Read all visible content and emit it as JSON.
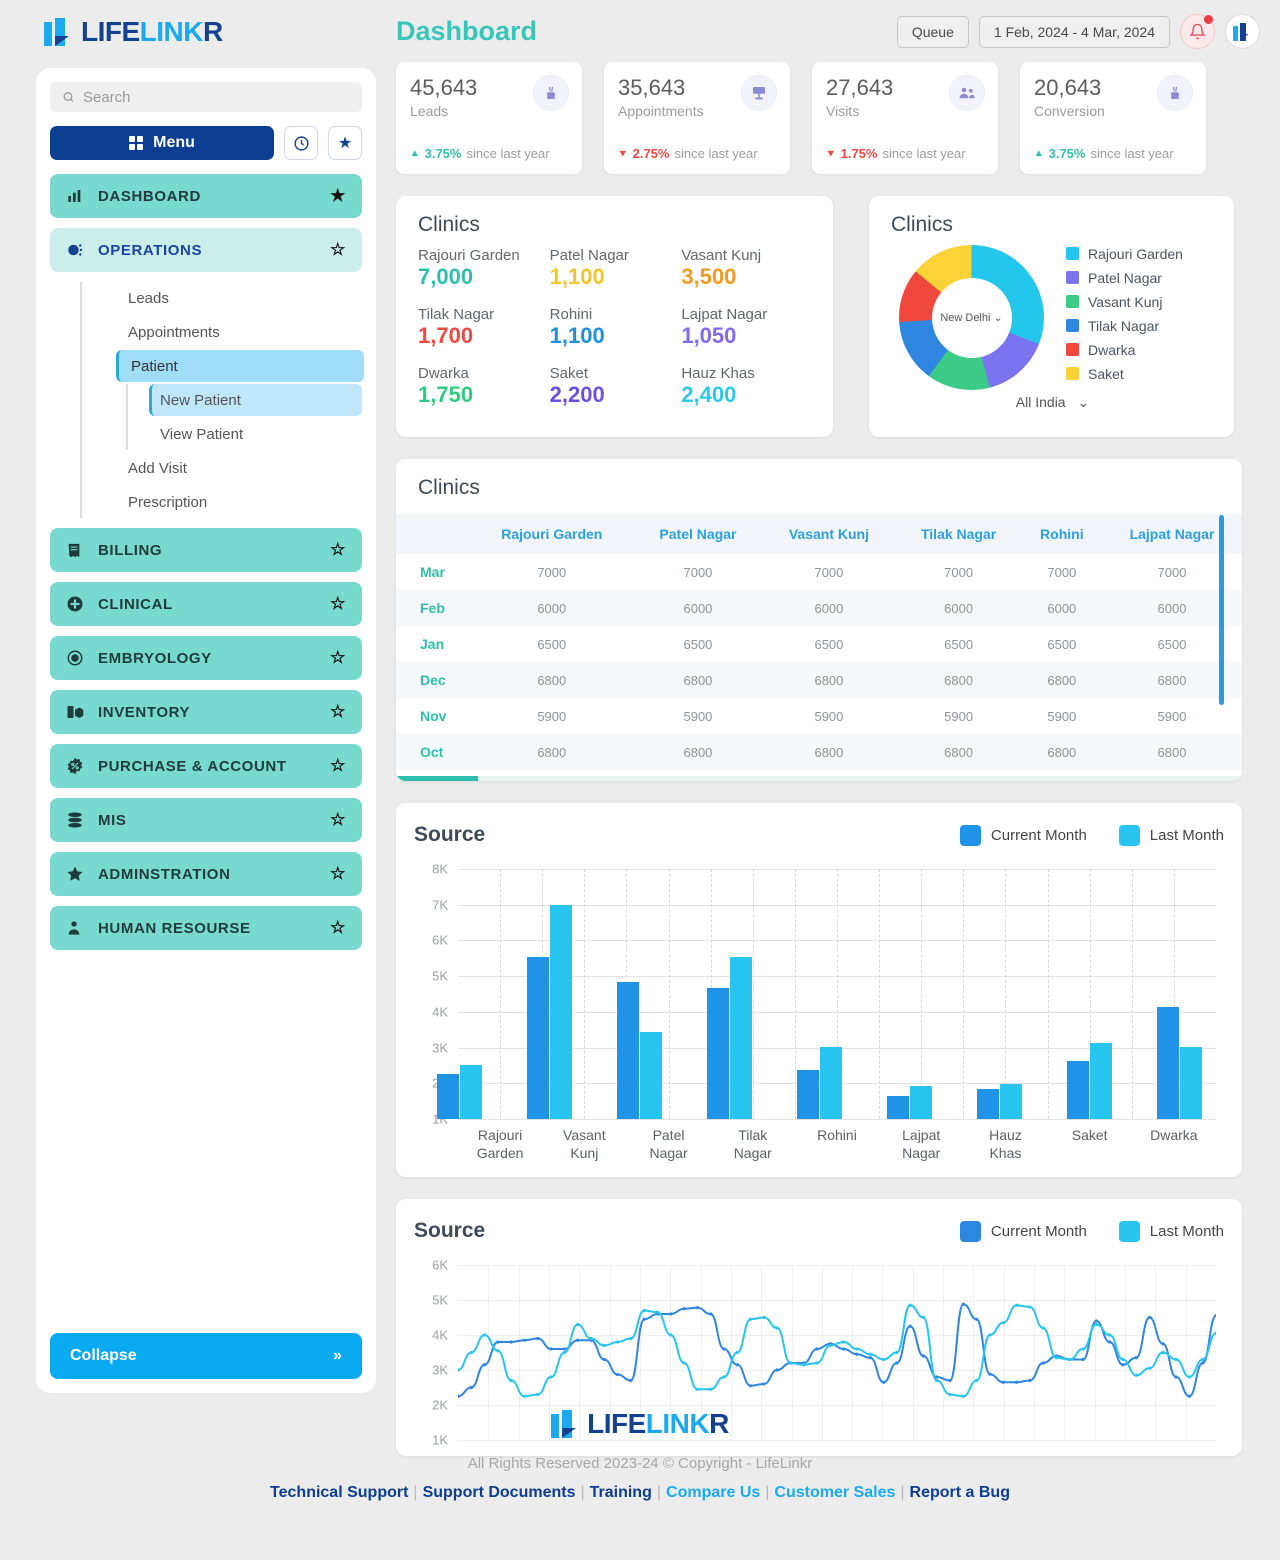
{
  "brand": {
    "part1": "LIFE",
    "part2": "LINK",
    "part3": "R",
    "logo_icon": "lifelinkr-logo-icon"
  },
  "header": {
    "title": "Dashboard",
    "queue_label": "Queue",
    "date_range": "1 Feb, 2024 - 4 Mar, 2024",
    "bell_icon": "notification-bell-icon",
    "logo_icon": "app-logo-icon"
  },
  "sidebar": {
    "search_placeholder": "Search",
    "search_value": "",
    "search_icon": "search-icon",
    "menu_label": "Menu",
    "menu_icon": "grid-icon",
    "history_icon": "history-clock-icon",
    "favorites_icon": "star-filled-icon",
    "collapse_label": "Collapse",
    "collapse_icon": "double-chevron-right-icon",
    "items": [
      {
        "label": "DASHBOARD",
        "icon": "bar-chart-icon",
        "star": "★",
        "style": "solid"
      },
      {
        "label": "OPERATIONS",
        "icon": "gear-cog-icon",
        "star": "☆",
        "style": "pale"
      },
      {
        "label": "BILLING",
        "icon": "receipt-icon",
        "star": "☆",
        "style": "solid"
      },
      {
        "label": "CLINICAL",
        "icon": "plus-circle-icon",
        "star": "☆",
        "style": "solid"
      },
      {
        "label": "EMBRYOLOGY",
        "icon": "embryo-circle-icon",
        "star": "☆",
        "style": "solid"
      },
      {
        "label": "INVENTORY",
        "icon": "inventory-box-icon",
        "star": "☆",
        "style": "solid"
      },
      {
        "label": "PURCHASE & ACCOUNT",
        "icon": "percent-badge-icon",
        "star": "☆",
        "style": "solid"
      },
      {
        "label": "MIS",
        "icon": "database-icon",
        "star": "☆",
        "style": "solid"
      },
      {
        "label": "ADMINSTRATION",
        "icon": "star-filled-icon",
        "star": "☆",
        "style": "solid"
      },
      {
        "label": "HUMAN RESOURSE",
        "icon": "user-tie-icon",
        "star": "☆",
        "style": "solid"
      }
    ],
    "operations_sub": [
      {
        "label": "Leads",
        "active": false
      },
      {
        "label": "Appointments",
        "active": false
      },
      {
        "label": "Patient",
        "active": true
      },
      {
        "label": "Add Visit",
        "active": false
      },
      {
        "label": "Prescription",
        "active": false
      }
    ],
    "patient_sub": [
      {
        "label": "New Patient",
        "active": true
      },
      {
        "label": "View Patient",
        "active": false
      }
    ]
  },
  "kpis": [
    {
      "value": "45,643",
      "label": "Leads",
      "change": "3.75%",
      "since": "since last year",
      "dir": "up",
      "icon": "leads-icon"
    },
    {
      "value": "35,643",
      "label": "Appointments",
      "change": "2.75%",
      "since": "since last year",
      "dir": "down",
      "icon": "appointments-icon"
    },
    {
      "value": "27,643",
      "label": "Visits",
      "change": "1.75%",
      "since": "since last year",
      "dir": "down",
      "icon": "visits-icon"
    },
    {
      "value": "20,643",
      "label": "Conversion",
      "change": "3.75%",
      "since": "since last year",
      "dir": "up",
      "icon": "conversion-icon"
    }
  ],
  "clinics_numbers": {
    "title": "Clinics",
    "items": [
      {
        "name": "Rajouri Garden",
        "value": "7,000",
        "color": "#2fc0ad"
      },
      {
        "name": "Patel Nagar",
        "value": "1,100",
        "color": "#f7c52b"
      },
      {
        "name": "Vasant Kunj",
        "value": "3,500",
        "color": "#f59a1e"
      },
      {
        "name": "Tilak Nagar",
        "value": "1,700",
        "color": "#ef4a42"
      },
      {
        "name": "Rohini",
        "value": "1,100",
        "color": "#1d8fe0"
      },
      {
        "name": "Lajpat Nagar",
        "value": "1,050",
        "color": "#8169f0"
      },
      {
        "name": "Dwarka",
        "value": "1,750",
        "color": "#2ecc80"
      },
      {
        "name": "Saket",
        "value": "2,200",
        "color": "#6a4fe0"
      },
      {
        "name": "Hauz Khas",
        "value": "2,400",
        "color": "#2cc9e8"
      }
    ]
  },
  "clinics_donut": {
    "title": "Clinics",
    "center_label": "New Delhi",
    "center_icon": "chevron-down-icon",
    "footer_label": "All India",
    "footer_icon": "chevron-down-icon"
  },
  "clinics_table": {
    "title": "Clinics",
    "columns": [
      "",
      "Rajouri Garden",
      "Patel Nagar",
      "Vasant Kunj",
      "Tilak Nagar",
      "Rohini",
      "Lajpat Nagar"
    ],
    "rows": [
      {
        "month": "Mar",
        "values": [
          "7000",
          "7000",
          "7000",
          "7000",
          "7000",
          "7000"
        ]
      },
      {
        "month": "Feb",
        "values": [
          "6000",
          "6000",
          "6000",
          "6000",
          "6000",
          "6000"
        ]
      },
      {
        "month": "Jan",
        "values": [
          "6500",
          "6500",
          "6500",
          "6500",
          "6500",
          "6500"
        ]
      },
      {
        "month": "Dec",
        "values": [
          "6800",
          "6800",
          "6800",
          "6800",
          "6800",
          "6800"
        ]
      },
      {
        "month": "Nov",
        "values": [
          "5900",
          "5900",
          "5900",
          "5900",
          "5900",
          "5900"
        ]
      },
      {
        "month": "Oct",
        "values": [
          "6800",
          "6800",
          "6800",
          "6800",
          "6800",
          "6800"
        ]
      }
    ]
  },
  "source_bar": {
    "title": "Source",
    "legend": [
      {
        "label": "Current Month",
        "color": "#1f93e8"
      },
      {
        "label": "Last Month",
        "color": "#27c5ef"
      }
    ]
  },
  "source_line": {
    "title": "Source",
    "legend": [
      {
        "label": "Current Month",
        "color": "#2f86e0"
      },
      {
        "label": "Last Month",
        "color": "#27c5ef"
      }
    ]
  },
  "chart_data": [
    {
      "type": "bar",
      "title": "Source",
      "categories": [
        "Rajouri Garden",
        "Vasant Kunj",
        "Patel Nagar",
        "Tilak Nagar",
        "Rohini",
        "Lajpat Nagar",
        "Hauz Khas",
        "Saket",
        "Dwarka"
      ],
      "series": [
        {
          "name": "Current Month",
          "color": "#1f93e8",
          "values": [
            2250,
            5550,
            4830,
            4680,
            2370,
            1640,
            1830,
            2620,
            4150
          ]
        },
        {
          "name": "Last Month",
          "color": "#27c5ef",
          "values": [
            2500,
            7000,
            3450,
            5550,
            3020,
            1930,
            1970,
            3130,
            3030
          ]
        }
      ],
      "xlabel": "",
      "ylabel": "",
      "ylim": [
        1000,
        8000
      ],
      "yticks": [
        "1K",
        "2K",
        "3K",
        "4K",
        "5K",
        "6K",
        "7K",
        "8K"
      ],
      "grid": true,
      "legend_position": "top-right"
    },
    {
      "type": "line",
      "title": "Source",
      "ylim": [
        1000,
        6000
      ],
      "yticks": [
        "1K",
        "2K",
        "3K",
        "4K",
        "5K",
        "6K"
      ],
      "grid": true,
      "legend_position": "top-right",
      "series": [
        {
          "name": "Current Month",
          "color": "#2f86e0",
          "values": [
            2250,
            2500,
            3150,
            3800,
            3800,
            3850,
            3900,
            3600,
            3600,
            3850,
            3850,
            3300,
            2870,
            2700,
            4450,
            4600,
            4600,
            4750,
            4780,
            4600,
            3600,
            3150,
            2550,
            2600,
            3000,
            3200,
            3200,
            3600,
            3750,
            3600,
            3450,
            3350,
            2650,
            3200,
            4250,
            3400,
            2800,
            2700,
            4880,
            4450,
            2880,
            2650,
            2650,
            2700,
            3200,
            3400,
            3300,
            3300,
            4400,
            3800,
            3150,
            3350,
            4500,
            3750,
            2800,
            2250,
            3200,
            4550
          ]
        },
        {
          "name": "Last Month",
          "color": "#27c5ef",
          "values": [
            3000,
            3500,
            4000,
            3550,
            2700,
            2250,
            2300,
            2800,
            3500,
            4300,
            3900,
            3700,
            3800,
            3900,
            4700,
            4650,
            4000,
            3200,
            2450,
            2450,
            2800,
            3500,
            4450,
            4500,
            4200,
            3200,
            3150,
            3200,
            3700,
            3800,
            3600,
            3450,
            3300,
            3500,
            4850,
            4500,
            2700,
            2300,
            2250,
            2700,
            4000,
            4350,
            4850,
            4800,
            4200,
            3350,
            3300,
            3600,
            4300,
            4000,
            3300,
            2850,
            3050,
            3500,
            3300,
            2800,
            3300,
            4050
          ]
        }
      ]
    },
    {
      "type": "pie",
      "title": "Clinics",
      "labels": [
        "Rajouri Garden",
        "Patel Nagar",
        "Vasant Kunj",
        "Tilak Nagar",
        "Dwarka",
        "Saket"
      ],
      "colors": [
        "#24c7ec",
        "#7b73ef",
        "#3ccb86",
        "#2f86e0",
        "#f0483d",
        "#f9d335"
      ],
      "values": [
        31,
        15,
        14,
        14,
        12,
        14
      ],
      "center_label": "New Delhi",
      "legend_position": "right"
    }
  ],
  "footer": {
    "copyright": "All Rights Reserved 2023-24 © Copyright - LifeLinkr",
    "links": [
      {
        "label": "Technical Support",
        "light": false
      },
      {
        "label": "Support Documents",
        "light": false
      },
      {
        "label": "Training",
        "light": false
      },
      {
        "label": "Compare Us",
        "light": true
      },
      {
        "label": "Customer Sales",
        "light": true
      },
      {
        "label": "Report a Bug",
        "light": false
      }
    ]
  }
}
